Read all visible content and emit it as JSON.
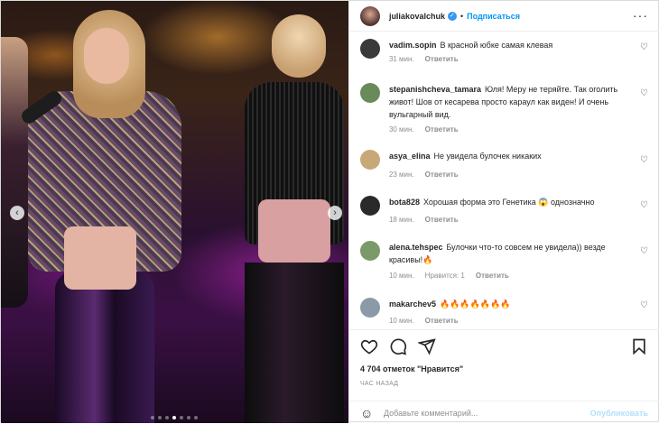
{
  "post": {
    "author": {
      "username": "juliakovalchuk",
      "verified": true,
      "follow_label": "Подписаться",
      "separator": "•"
    },
    "more_icon": "more-horizontal-icon",
    "carousel": {
      "total": 7,
      "active_index": 3
    }
  },
  "comments": [
    {
      "username": "vadim.sopin",
      "text": "В красной юбке самая клевая",
      "time": "31 мин.",
      "likes": "",
      "reply_label": "Ответить",
      "avatar_color": "#3a3a3a"
    },
    {
      "username": "stepanishcheva_tamara",
      "text": "Юля! Меру не теряйте. Так оголить живот! Шов от кесарева просто караул как виден! И очень вульгарный вид.",
      "time": "30 мин.",
      "likes": "",
      "reply_label": "Ответить",
      "avatar_color": "#6b8a5a"
    },
    {
      "username": "asya_elina",
      "text": "Не увидела булочек никаких",
      "time": "23 мин.",
      "likes": "",
      "reply_label": "Ответить",
      "avatar_color": "#c9a878"
    },
    {
      "username": "bota828",
      "text": "Хорошая форма это Генетика 😱 однозначно",
      "time": "18 мин.",
      "likes": "",
      "reply_label": "Ответить",
      "avatar_color": "#2a2a2a"
    },
    {
      "username": "alena.tehspec",
      "text": "Булочки что-то совсем не увидела)) везде красивы!🔥",
      "time": "10 мин.",
      "likes": "Нравится: 1",
      "reply_label": "Ответить",
      "avatar_color": "#7a9a6a"
    },
    {
      "username": "makarchev5",
      "text": "🔥🔥🔥🔥🔥🔥🔥",
      "time": "10 мин.",
      "likes": "",
      "reply_label": "Ответить",
      "avatar_color": "#8a9aa8"
    }
  ],
  "actions": {
    "likes_text": "4 704 отметок \"Нравится\"",
    "time_ago": "ЧАС НАЗАД",
    "comment_placeholder": "Добавьте комментарий...",
    "publish_label": "Опубликовать",
    "emoji_icon": "☺"
  },
  "colors": {
    "accent": "#0095f6",
    "muted": "#8e8e8e",
    "border": "#efefef"
  }
}
